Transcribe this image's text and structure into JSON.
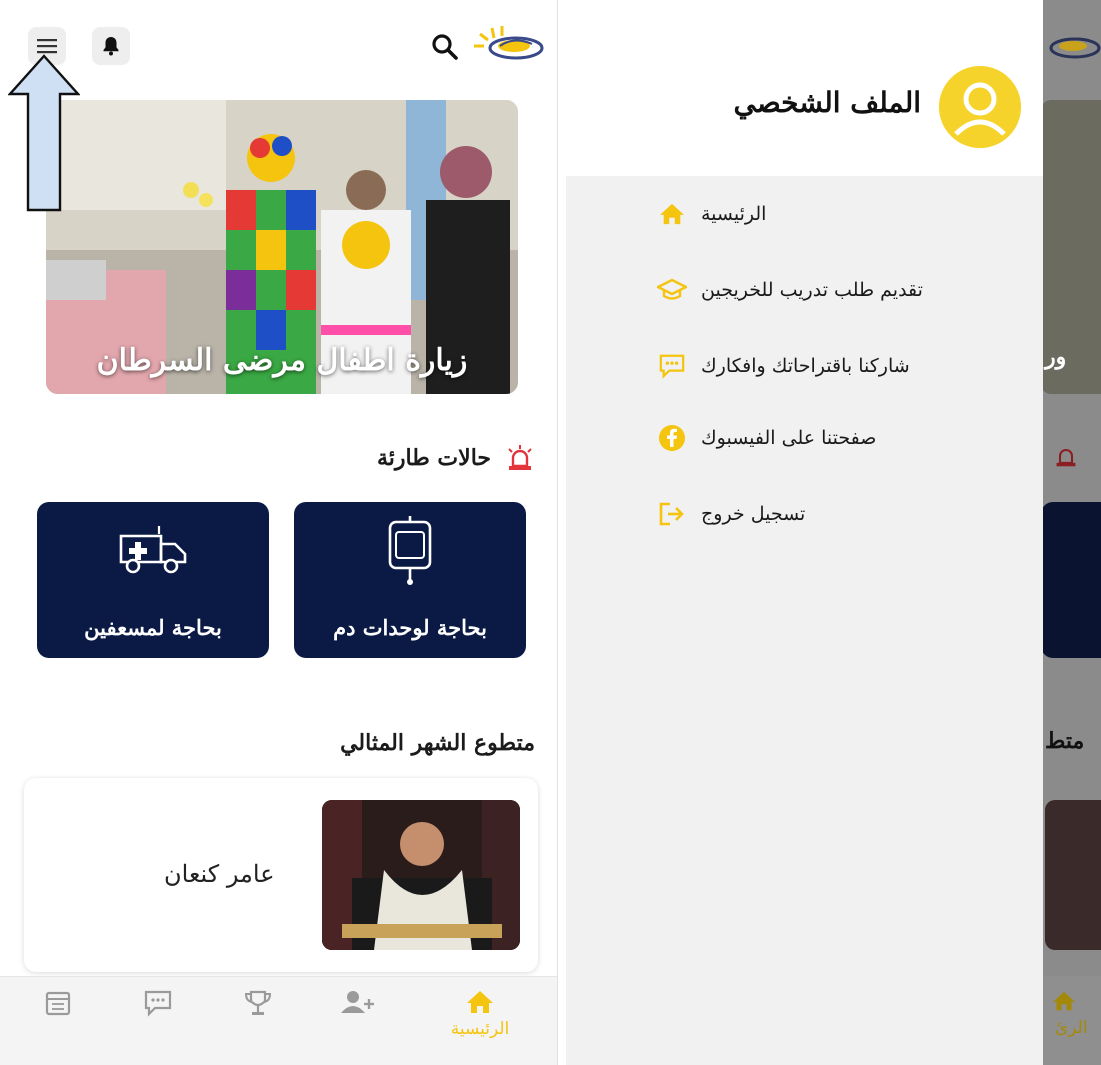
{
  "colors": {
    "accent": "#f4c40f",
    "navy": "#0a1a44",
    "drawer_bg": "#f1f1f1",
    "alert_red": "#e3343c"
  },
  "left_screen": {
    "banner": {
      "caption": "زيارة اطفال مرضى السرطان"
    },
    "emergency": {
      "title": "حالات طارئة",
      "icon": "siren-icon",
      "cards": [
        {
          "label": "بحاجة لوحدات دم",
          "icon": "blood-bag-icon"
        },
        {
          "label": "بحاجة لمسعفين",
          "icon": "ambulance-icon"
        }
      ]
    },
    "volunteer": {
      "title": "متطوع الشهر المثالي",
      "name": "عامر كنعان"
    },
    "bottom_nav": {
      "active_label": "الرئيسية",
      "items": [
        "home-icon",
        "add-user-icon",
        "trophy-icon",
        "chat-icon",
        "calendar-icon"
      ]
    }
  },
  "drawer": {
    "profile_title": "الملف الشخصي",
    "menu": [
      {
        "label": "الرئيسية",
        "icon": "home-icon"
      },
      {
        "label": "تقديم طلب تدريب للخريجين",
        "icon": "graduation-cap-icon"
      },
      {
        "label": "شاركنا باقتراحاتك وافكارك",
        "icon": "chat-bubble-icon"
      },
      {
        "label": "صفحتنا على الفيسبوك",
        "icon": "facebook-icon"
      },
      {
        "label": "تسجيل خروج",
        "icon": "logout-icon"
      }
    ],
    "underlay": {
      "text_1": "ور",
      "text_2": "متط",
      "nav_label": "الرئ"
    }
  }
}
